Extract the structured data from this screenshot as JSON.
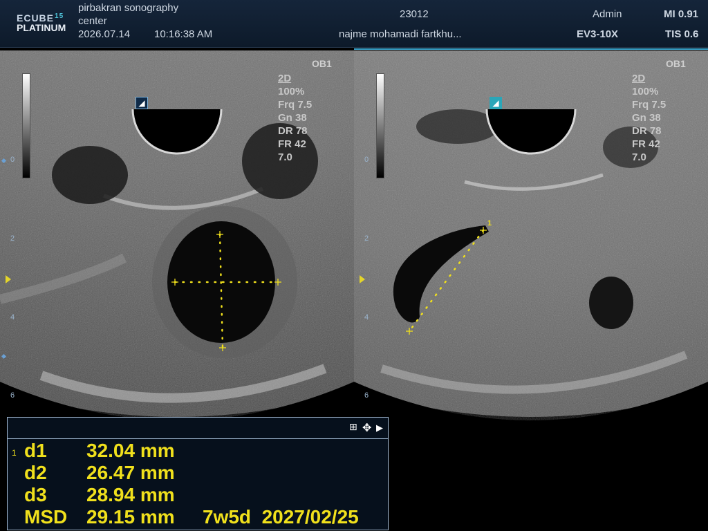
{
  "header": {
    "logo_line1": "ECUBE",
    "logo_num": "15",
    "logo_line2": "PLATINUM",
    "institution_line1": "pirbakran sonography",
    "institution_line2": "center",
    "date": "2026.07.14",
    "time": "10:16:38  AM",
    "patient_id": "23012",
    "patient_name": "najme mohamadi fartkhu...",
    "operator": "Admin",
    "probe": "EV3-10X",
    "mi": "MI 0.91",
    "tis": "TIS 0.6"
  },
  "panels": [
    {
      "preset": "OB1",
      "params": [
        "2D",
        "100%",
        "Frq 7.5",
        "Gn 38",
        "DR 78",
        "FR 42",
        "7.0"
      ],
      "orientation_icon": "probe-orientation-icon"
    },
    {
      "preset": "OB1",
      "params": [
        "2D",
        "100%",
        "Frq 7.5",
        "Gn 38",
        "DR 78",
        "FR 42",
        "7.0"
      ],
      "orientation_icon": "probe-orientation-icon",
      "caliper_label": "1"
    }
  ],
  "depth_labels": [
    "0",
    "2",
    "4",
    "6"
  ],
  "measurements": {
    "index": "1",
    "rows": [
      {
        "label": "d1",
        "value": "32.04 mm",
        "extra": ""
      },
      {
        "label": "d2",
        "value": "26.47 mm",
        "extra": ""
      },
      {
        "label": "d3",
        "value": "28.94 mm",
        "extra": ""
      },
      {
        "label": "MSD",
        "value": "29.15 mm",
        "extra": "7w5d  2027/02/25"
      }
    ],
    "controls": [
      "grid-icon",
      "move-icon",
      "expand-arrow-icon"
    ]
  },
  "colors": {
    "header_bg": "#15253a",
    "accent_blue": "#3aa7d0",
    "caliper_yellow": "#f0e01c",
    "measure_text": "#f0e01c"
  }
}
